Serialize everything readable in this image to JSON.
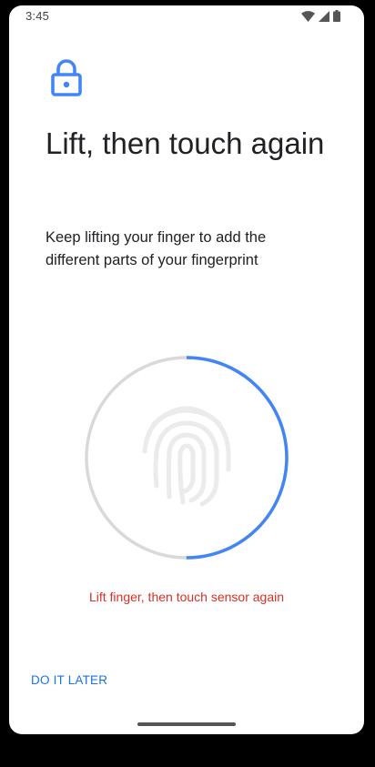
{
  "status_bar": {
    "time": "3:45",
    "icons": [
      "wifi-icon",
      "cellular-signal-icon",
      "battery-icon"
    ]
  },
  "header": {
    "icon": "lock-icon",
    "title": "Lift, then touch again",
    "subtitle": "Keep lifting your finger to add the different parts of your fingerprint"
  },
  "sensor": {
    "icon": "fingerprint-icon",
    "progress": 0.5
  },
  "message": "Lift finger, then touch sensor again",
  "footer": {
    "skip_label": "DO IT LATER"
  },
  "colors": {
    "accent": "#1a73e8",
    "progress": "#4285f4",
    "track": "#d9d9d9",
    "error": "#d93025"
  }
}
